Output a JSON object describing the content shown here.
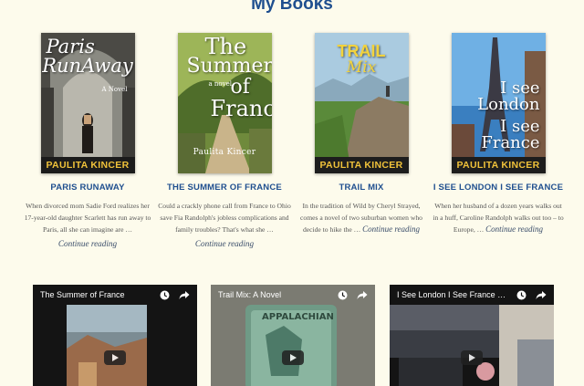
{
  "section_title": "My Books",
  "books": [
    {
      "cover_title_1": "Paris",
      "cover_title_2": "RunAway",
      "cover_sub": "A Novel",
      "cover_author": "PAULITA KINCER",
      "title": "PARIS RUNAWAY",
      "excerpt": "When divorced mom Sadie Ford realizes her 17-year-old daughter Scarlett has run away to Paris, all she can imagine are …",
      "more": "",
      "continue": "Continue reading"
    },
    {
      "cover_title_1": "The",
      "cover_title_2": "Summer",
      "cover_title_3": "of",
      "cover_title_4": "France",
      "cover_sub": "a novel",
      "cover_author": "Paulita Kincer",
      "title": "THE SUMMER OF FRANCE",
      "excerpt": "Could a crackly phone call from France to Ohio save Fia Randolph's jobless complications and family troubles? That's what she …",
      "more": "",
      "continue": "Continue reading"
    },
    {
      "cover_title_1": "TRAIL",
      "cover_title_2": "Mix",
      "cover_author": "PAULITA KINCER",
      "title": "TRAIL MIX",
      "excerpt": "In the tradition of Wild by Cheryl Strayed, comes a novel of two suburban women who decide to hike the … ",
      "more": "Continue reading",
      "continue": ""
    },
    {
      "cover_title_1": "I see",
      "cover_title_2": "London",
      "cover_title_3": "I see",
      "cover_title_4": "France",
      "cover_author": "PAULITA KINCER",
      "title": "I SEE LONDON I SEE FRANCE",
      "excerpt": "When her husband of a dozen years walks out in a huff, Caroline Randolph walks out too – to Europe, … ",
      "more": "Continue reading",
      "continue": ""
    }
  ],
  "videos": [
    {
      "title": "The Summer of France"
    },
    {
      "title": "Trail Mix: A Novel"
    },
    {
      "title": "I See London I See France boo..."
    }
  ],
  "colors": {
    "background": "#fdfbec",
    "heading": "#1f4f8f"
  },
  "icons": [
    "clock-icon",
    "share-icon",
    "play-icon"
  ]
}
